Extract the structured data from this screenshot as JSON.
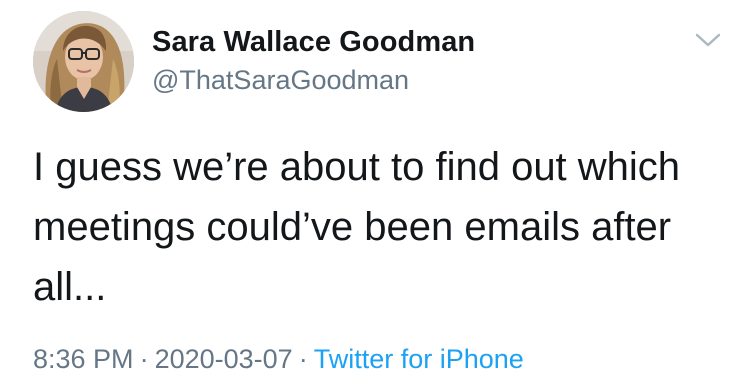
{
  "author": {
    "name": "Sara Wallace Goodman",
    "handle": "@ThatSaraGoodman"
  },
  "tweet": {
    "text": "I guess we’re about to find out which\nmeetings could’ve been emails after\nall..."
  },
  "meta": {
    "time": "8:36 PM",
    "separator": "·",
    "date": "2020-03-07",
    "source": "Twitter for iPhone"
  },
  "icons": {
    "more": "chevron-down-icon"
  },
  "colors": {
    "text_primary": "#14171a",
    "text_secondary": "#657786",
    "link": "#1da1f2"
  }
}
